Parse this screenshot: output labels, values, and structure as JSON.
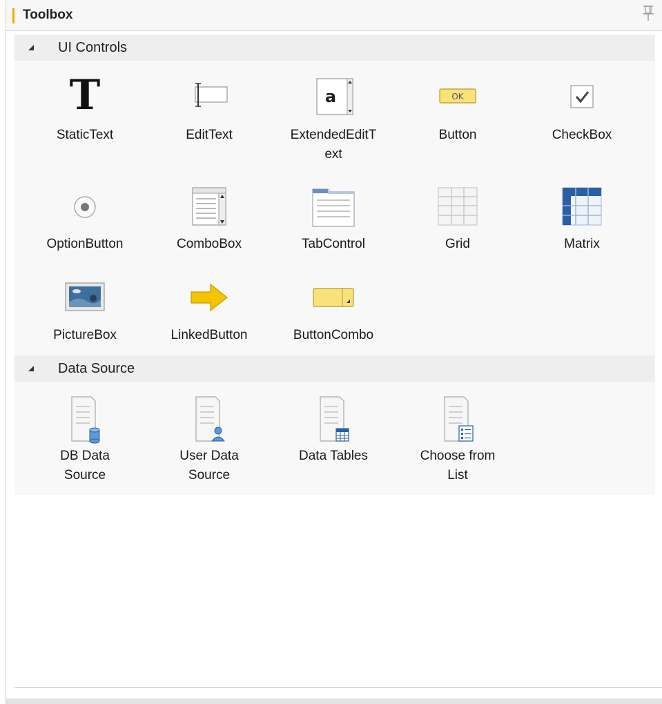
{
  "toolbox": {
    "title": "Toolbox",
    "pin_icon": "pin-icon"
  },
  "sections": {
    "ui_controls": {
      "label": "UI Controls",
      "expanded": true,
      "items": [
        {
          "label": "StaticText",
          "icon": "static-text-icon"
        },
        {
          "label": "EditText",
          "icon": "edit-text-icon"
        },
        {
          "label": "ExtendedEditT\next",
          "icon": "extended-edit-text-icon"
        },
        {
          "label": "Button",
          "icon": "button-icon"
        },
        {
          "label": "CheckBox",
          "icon": "checkbox-icon"
        },
        {
          "label": "OptionButton",
          "icon": "option-button-icon"
        },
        {
          "label": "ComboBox",
          "icon": "combobox-icon"
        },
        {
          "label": "TabControl",
          "icon": "tab-control-icon"
        },
        {
          "label": "Grid",
          "icon": "grid-icon"
        },
        {
          "label": "Matrix",
          "icon": "matrix-icon"
        },
        {
          "label": "PictureBox",
          "icon": "picture-box-icon"
        },
        {
          "label": "LinkedButton",
          "icon": "linked-button-icon"
        },
        {
          "label": "ButtonCombo",
          "icon": "button-combo-icon"
        }
      ],
      "button_icon_text": "OK",
      "extended_icon_text": "a"
    },
    "data_source": {
      "label": "Data Source",
      "expanded": true,
      "items": [
        {
          "label": "DB Data\nSource",
          "icon": "db-data-source-icon"
        },
        {
          "label": "User Data\nSource",
          "icon": "user-data-source-icon"
        },
        {
          "label": "Data Tables",
          "icon": "data-tables-icon"
        },
        {
          "label": "Choose from\nList",
          "icon": "choose-from-list-icon"
        }
      ]
    }
  },
  "colors": {
    "accent": "#f0ab00",
    "header_bg": "#eeeeee",
    "body_bg": "#f8f8f8",
    "matrix_blue": "#2a5fa8",
    "button_yellow": "#f9e27a"
  }
}
